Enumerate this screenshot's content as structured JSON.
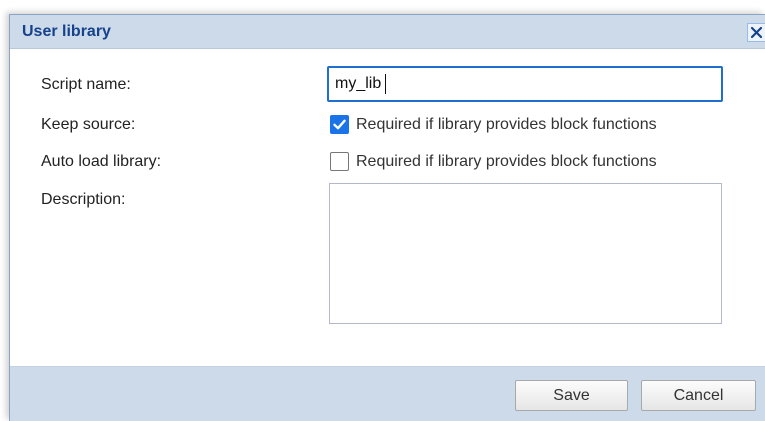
{
  "dialog": {
    "title": "User library",
    "close_icon": "close-icon"
  },
  "form": {
    "script_name_label": "Script name:",
    "script_name_value": "my_lib",
    "keep_source_label": "Keep source:",
    "keep_source_checked": true,
    "keep_source_hint": "Required if library provides block functions",
    "auto_load_label": "Auto load library:",
    "auto_load_checked": false,
    "auto_load_hint": "Required if library provides block functions",
    "description_label": "Description:",
    "description_value": ""
  },
  "footer": {
    "save_label": "Save",
    "cancel_label": "Cancel"
  },
  "colors": {
    "title_bar": "#cddaea",
    "title_text": "#15428b",
    "checkbox_checked": "#1a73e8",
    "input_focus_border": "#1f6fd0"
  }
}
